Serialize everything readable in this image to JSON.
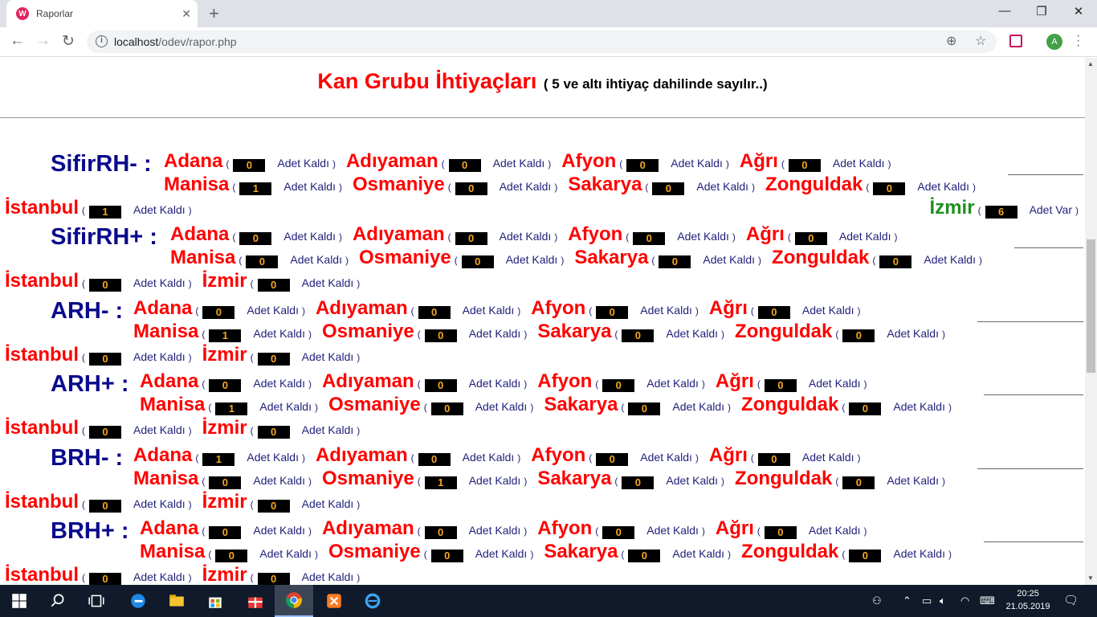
{
  "browser": {
    "tab_title": "Raporlar",
    "tab_favicon": "W",
    "new_tab": "+",
    "url_host": "localhost",
    "url_path": "/odev/rapor.php",
    "profile_initial": "A"
  },
  "page": {
    "title": "Kan Grubu İhtiyaçları",
    "subtitle": "( 5 ve altı ihtiyaç dahilinde sayılır..)"
  },
  "labels": {
    "open": "(",
    "close": ")",
    "remaining": "Adet Kaldı",
    "available": "Adet Var"
  },
  "groups": [
    {
      "name": "SifirRH- :",
      "row1": [
        {
          "city": "Adana",
          "count": "0"
        },
        {
          "city": "Adıyaman",
          "count": "0"
        },
        {
          "city": "Afyon",
          "count": "0"
        },
        {
          "city": "Ağrı",
          "count": "0"
        }
      ],
      "row2": [
        {
          "city": "Manisa",
          "count": "1"
        },
        {
          "city": "Osmaniye",
          "count": "0"
        },
        {
          "city": "Sakarya",
          "count": "0"
        },
        {
          "city": "Zonguldak",
          "count": "0"
        }
      ],
      "row3": [
        {
          "city": "İstanbul",
          "count": "1"
        }
      ],
      "extra": {
        "city": "İzmir",
        "count": "6"
      }
    },
    {
      "name": "SifirRH+ :",
      "row1": [
        {
          "city": "Adana",
          "count": "0"
        },
        {
          "city": "Adıyaman",
          "count": "0"
        },
        {
          "city": "Afyon",
          "count": "0"
        },
        {
          "city": "Ağrı",
          "count": "0"
        }
      ],
      "row2": [
        {
          "city": "Manisa",
          "count": "0"
        },
        {
          "city": "Osmaniye",
          "count": "0"
        },
        {
          "city": "Sakarya",
          "count": "0"
        },
        {
          "city": "Zonguldak",
          "count": "0"
        }
      ],
      "row3": [
        {
          "city": "İstanbul",
          "count": "0"
        },
        {
          "city": "İzmir",
          "count": "0"
        }
      ]
    },
    {
      "name": "ARH- :",
      "row1": [
        {
          "city": "Adana",
          "count": "0"
        },
        {
          "city": "Adıyaman",
          "count": "0"
        },
        {
          "city": "Afyon",
          "count": "0"
        },
        {
          "city": "Ağrı",
          "count": "0"
        }
      ],
      "row2": [
        {
          "city": "Manisa",
          "count": "1"
        },
        {
          "city": "Osmaniye",
          "count": "0"
        },
        {
          "city": "Sakarya",
          "count": "0"
        },
        {
          "city": "Zonguldak",
          "count": "0"
        }
      ],
      "row3": [
        {
          "city": "İstanbul",
          "count": "0"
        },
        {
          "city": "İzmir",
          "count": "0"
        }
      ]
    },
    {
      "name": "ARH+ :",
      "row1": [
        {
          "city": "Adana",
          "count": "0"
        },
        {
          "city": "Adıyaman",
          "count": "0"
        },
        {
          "city": "Afyon",
          "count": "0"
        },
        {
          "city": "Ağrı",
          "count": "0"
        }
      ],
      "row2": [
        {
          "city": "Manisa",
          "count": "1"
        },
        {
          "city": "Osmaniye",
          "count": "0"
        },
        {
          "city": "Sakarya",
          "count": "0"
        },
        {
          "city": "Zonguldak",
          "count": "0"
        }
      ],
      "row3": [
        {
          "city": "İstanbul",
          "count": "0"
        },
        {
          "city": "İzmir",
          "count": "0"
        }
      ]
    },
    {
      "name": "BRH- :",
      "row1": [
        {
          "city": "Adana",
          "count": "1"
        },
        {
          "city": "Adıyaman",
          "count": "0"
        },
        {
          "city": "Afyon",
          "count": "0"
        },
        {
          "city": "Ağrı",
          "count": "0"
        }
      ],
      "row2": [
        {
          "city": "Manisa",
          "count": "0"
        },
        {
          "city": "Osmaniye",
          "count": "1"
        },
        {
          "city": "Sakarya",
          "count": "0"
        },
        {
          "city": "Zonguldak",
          "count": "0"
        }
      ],
      "row3": [
        {
          "city": "İstanbul",
          "count": "0"
        },
        {
          "city": "İzmir",
          "count": "0"
        }
      ]
    },
    {
      "name": "BRH+ :",
      "row1": [
        {
          "city": "Adana",
          "count": "0"
        },
        {
          "city": "Adıyaman",
          "count": "0"
        },
        {
          "city": "Afyon",
          "count": "0"
        },
        {
          "city": "Ağrı",
          "count": "0"
        }
      ],
      "row2": [
        {
          "city": "Manisa",
          "count": "0"
        },
        {
          "city": "Osmaniye",
          "count": "0"
        },
        {
          "city": "Sakarya",
          "count": "0"
        },
        {
          "city": "Zonguldak",
          "count": "0"
        }
      ],
      "row3": [
        {
          "city": "İstanbul",
          "count": "0"
        },
        {
          "city": "İzmir",
          "count": "0"
        }
      ]
    }
  ],
  "taskbar": {
    "time": "20:25",
    "date": "21.05.2019"
  },
  "colors": {
    "city_need": "#ff0000",
    "city_ok": "#1e8f1e",
    "group_name": "#0a0a8c",
    "count_text": "#f5a623"
  }
}
